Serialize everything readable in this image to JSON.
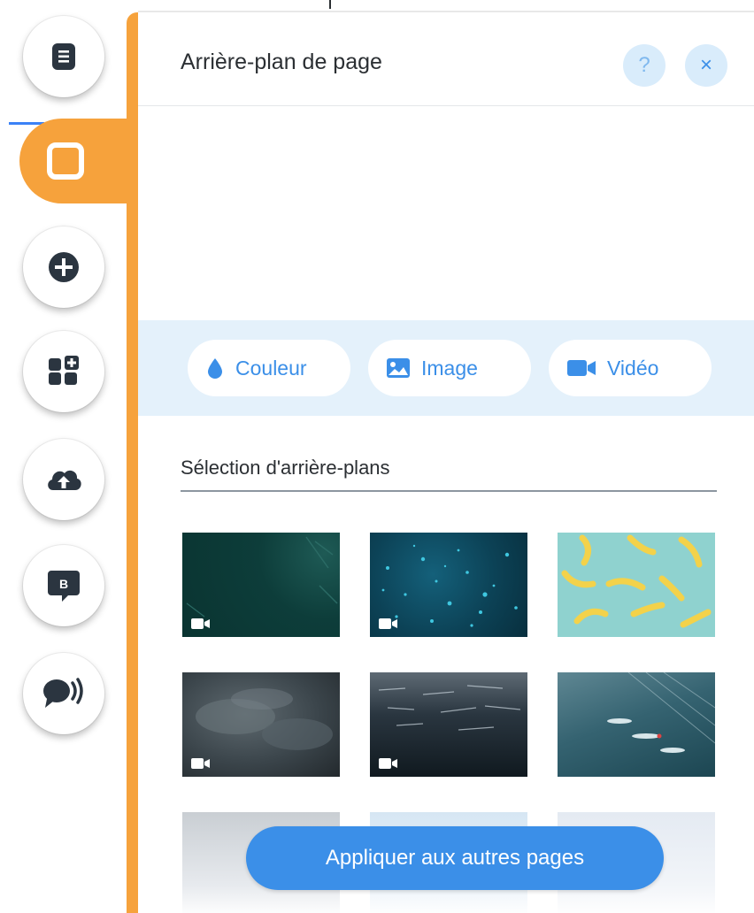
{
  "rail": {
    "items": [
      {
        "name": "pages",
        "icon": "page-icon"
      },
      {
        "name": "background",
        "icon": "square-icon",
        "active": true
      },
      {
        "name": "add",
        "icon": "plus-circle-icon"
      },
      {
        "name": "apps",
        "icon": "add-apps-icon"
      },
      {
        "name": "upload",
        "icon": "cloud-upload-icon"
      },
      {
        "name": "blog",
        "icon": "blog-icon",
        "glyph": "B"
      },
      {
        "name": "chat",
        "icon": "chat-icon"
      }
    ],
    "accent_color": "#f6a23c",
    "icon_color": "#2b3540"
  },
  "panel": {
    "title": "Arrière-plan de page",
    "help_label": "?",
    "close_label": "×",
    "types": [
      {
        "label": "Couleur",
        "icon": "drop-icon"
      },
      {
        "label": "Image",
        "icon": "image-icon"
      },
      {
        "label": "Vidéo",
        "icon": "video-icon"
      }
    ],
    "section_title": "Sélection d'arrière-plans",
    "thumbnails": [
      {
        "kind": "video",
        "description": "dark teal"
      },
      {
        "kind": "video",
        "description": "blue particles"
      },
      {
        "kind": "image",
        "description": "bananas"
      },
      {
        "kind": "video",
        "description": "storm clouds"
      },
      {
        "kind": "video",
        "description": "dark water"
      },
      {
        "kind": "image",
        "description": "swimmers"
      },
      {
        "kind": "image",
        "description": "light grey"
      },
      {
        "kind": "image",
        "description": "light blue"
      },
      {
        "kind": "image",
        "description": "pale blue"
      }
    ],
    "apply_label": "Appliquer aux autres pages",
    "accent_color": "#3b8fe8"
  }
}
